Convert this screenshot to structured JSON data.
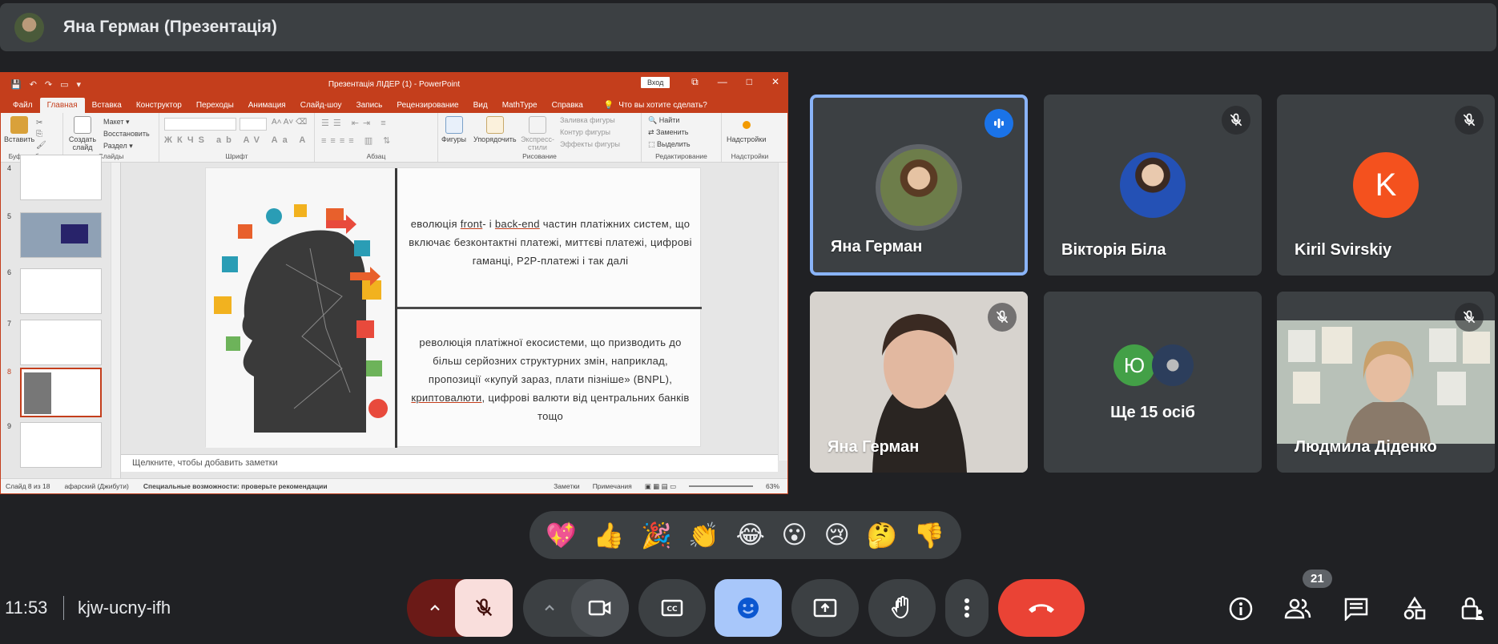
{
  "presenter_bar": {
    "title": "Яна Герман (Презентація)"
  },
  "ppt": {
    "window_title": "Презентація ЛІДЕР (1)  -  PowerPoint",
    "signin": "Вход",
    "tabs": [
      "Файл",
      "Главная",
      "Вставка",
      "Конструктор",
      "Переходы",
      "Анимация",
      "Слайд-шоу",
      "Запись",
      "Рецензирование",
      "Вид",
      "MathType",
      "Справка"
    ],
    "tell_me": "Что вы хотите сделать?",
    "ribbon": {
      "clipboard": {
        "paste": "Вставить",
        "label": "Буфер обмена"
      },
      "slides": {
        "new": "Создать слайд",
        "layout": "Макет",
        "reset": "Восстановить",
        "section": "Раздел",
        "label": "Слайды"
      },
      "font": {
        "label": "Шрифт"
      },
      "paragraph": {
        "label": "Абзац"
      },
      "drawing": {
        "shapes": "Фигуры",
        "arrange": "Упорядочить",
        "quick": "Экспресс-стили",
        "fill": "Заливка фигуры",
        "outline": "Контур фигуры",
        "effects": "Эффекты фигуры",
        "label": "Рисование"
      },
      "editing": {
        "find": "Найти",
        "replace": "Заменить",
        "select": "Выделить",
        "label": "Редактирование"
      },
      "addins": {
        "btn": "Надстройки",
        "label": "Надстройки"
      }
    },
    "thumbnails": [
      "4",
      "5",
      "6",
      "7",
      "8",
      "9"
    ],
    "slide": {
      "block1_pre": "еволюція ",
      "block1_front": "front",
      "block1_mid": "- і ",
      "block1_back": "back-end",
      "block1_rest": " частин платіжних систем, що включає безконтактні платежі, миттєві платежі, цифрові гаманці, P2P-платежі і так далі",
      "block2_pre": "революція платіжної екосистеми, що призводить до більш серйозних структурних змін, наприклад, пропозиції «купуй зараз, плати пізніше» (BNPL), ",
      "block2_crypto": "криптовалюти",
      "block2_rest": ", цифрові валюти від центральних банків тощо"
    },
    "notes_placeholder": "Щелкните, чтобы добавить заметки",
    "status": {
      "slide": "Слайд 8 из 18",
      "lang": "афарский (Джибути)",
      "access": "Специальные возможности: проверьте рекомендации",
      "notes": "Заметки",
      "comments": "Примечания",
      "zoom": "63%"
    }
  },
  "tiles": [
    {
      "name": "Яна Герман",
      "state": "speaking"
    },
    {
      "name": "Вікторія Біла",
      "state": "muted"
    },
    {
      "name": "Kiril Svirskiy",
      "initial": "K",
      "state": "muted"
    },
    {
      "name": "Яна Герман",
      "state": "muted"
    },
    {
      "name": "Ще 15 осіб",
      "initial": "Ю"
    },
    {
      "name": "Людмила Діденко",
      "state": "muted"
    }
  ],
  "reactions": [
    "💖",
    "👍",
    "🎉",
    "👏",
    "😂",
    "😮",
    "😢",
    "🤔",
    "👎"
  ],
  "meeting": {
    "time": "11:53",
    "code": "kjw-ucny-ifh",
    "participants_count": "21"
  },
  "colors": {
    "bg": "#202124",
    "tile": "#3c4043",
    "accent": "#8ab4f8",
    "end_call": "#ea4335",
    "ppt_red": "#c43e1c"
  }
}
